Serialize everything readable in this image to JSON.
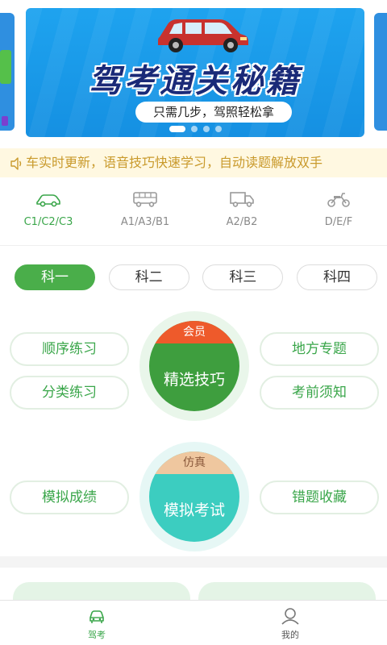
{
  "banner": {
    "title": "驾考通关秘籍",
    "subtitle": "只需几步，驾照轻松拿",
    "dots": 4,
    "active_dot": 0
  },
  "notice": {
    "icon": "speaker-icon",
    "text": "车实时更新，语音技巧快速学习，自动读题解放双手"
  },
  "vehicles": [
    {
      "label": "C1/C2/C3",
      "icon": "car-icon",
      "active": true
    },
    {
      "label": "A1/A3/B1",
      "icon": "bus-icon",
      "active": false
    },
    {
      "label": "A2/B2",
      "icon": "truck-icon",
      "active": false
    },
    {
      "label": "D/E/F",
      "icon": "motorcycle-icon",
      "active": false
    }
  ],
  "subjects": [
    {
      "label": "科一",
      "active": true
    },
    {
      "label": "科二",
      "active": false
    },
    {
      "label": "科三",
      "active": false
    },
    {
      "label": "科四",
      "active": false
    }
  ],
  "practice": {
    "sequential": "顺序练习",
    "category": "分类练习",
    "local_topics": "地方专题",
    "pre_exam": "考前须知",
    "skills_badge": "会员",
    "skills": "精选技巧",
    "mock_scores": "模拟成绩",
    "wrong_collection": "错题收藏",
    "exam_badge": "仿真",
    "exam": "模拟考试"
  },
  "tabbar": [
    {
      "label": "驾考",
      "icon": "car-tab-icon",
      "active": true
    },
    {
      "label": "我的",
      "icon": "profile-icon",
      "active": false
    }
  ],
  "colors": {
    "accent": "#4aae4a",
    "banner_bg": "#1ea3ef",
    "notice_bg": "#fff8e1",
    "notice_text": "#c99a2c",
    "member_badge": "#ee5a2b",
    "exam_circle": "#3ccdc0"
  }
}
